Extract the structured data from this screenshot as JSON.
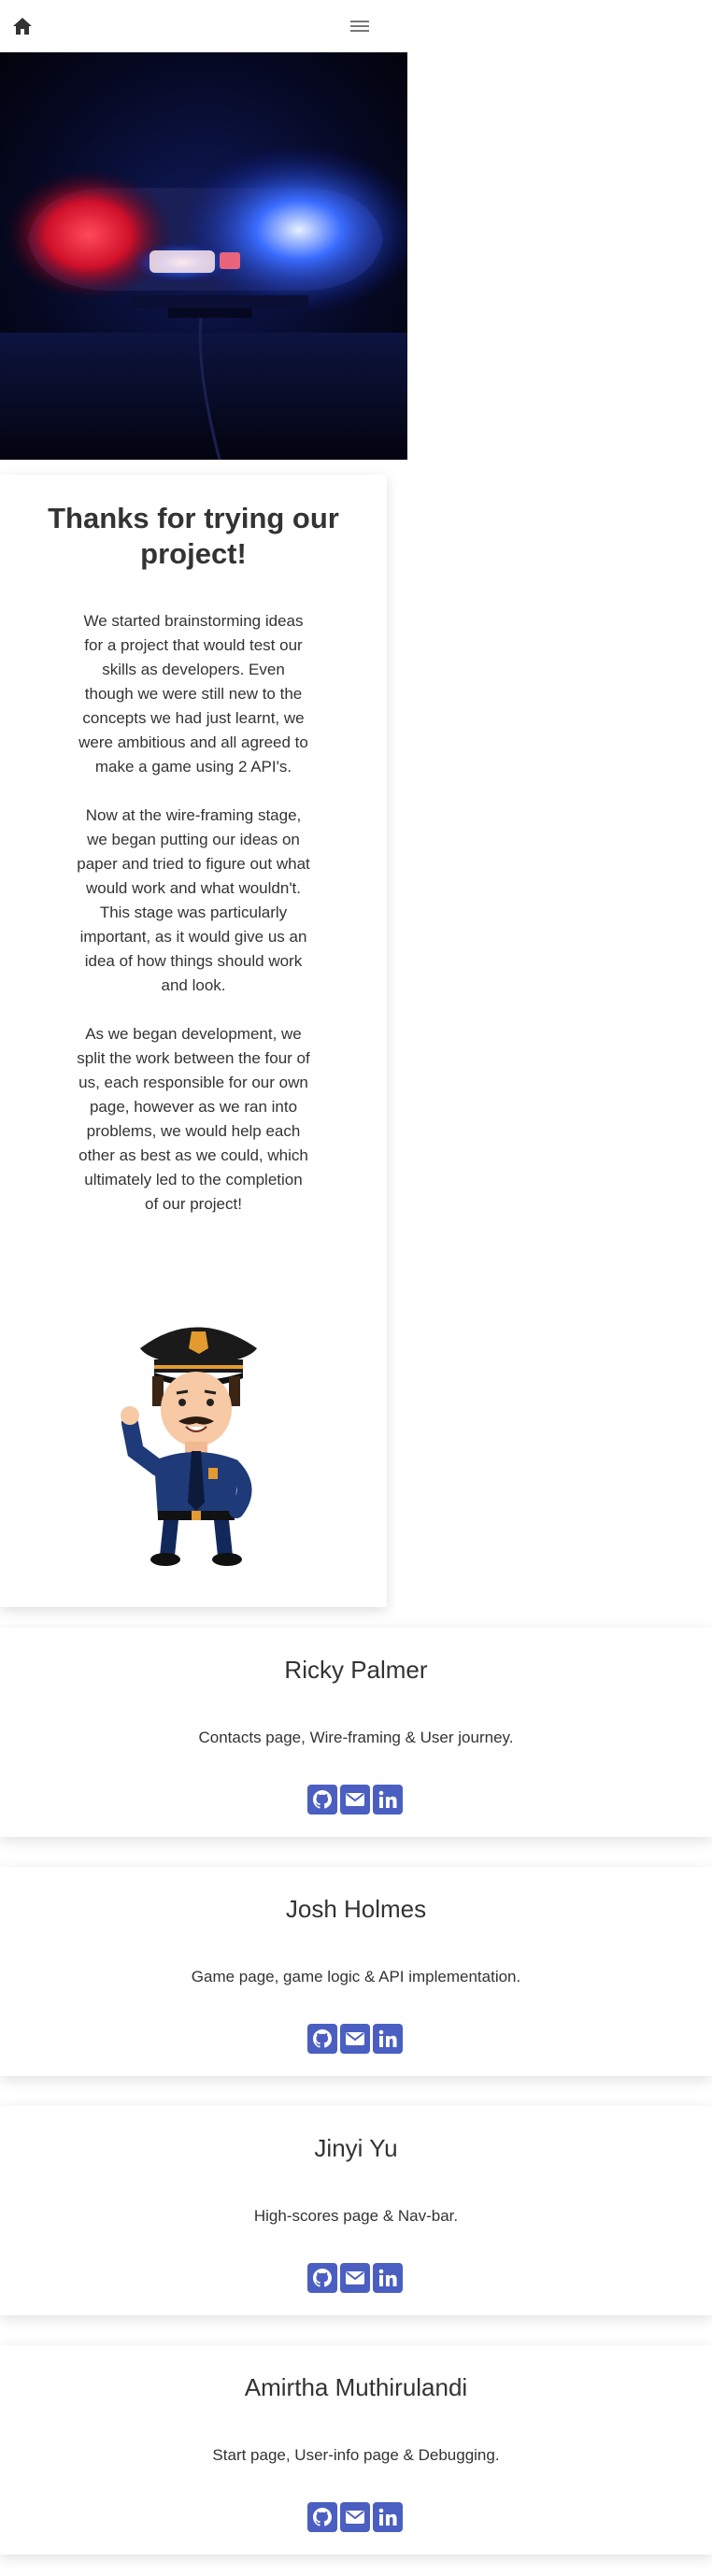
{
  "nav": {
    "home_icon": "home-icon",
    "menu_icon": "hamburger-menu-icon"
  },
  "about": {
    "title": "Thanks for trying our project!",
    "paragraphs": [
      "We started brainstorming ideas for a project that would test our skills as developers. Even though we were still new to the concepts we had just learnt, we were ambitious and all agreed to make a game using 2 API's.",
      "Now at the wire-framing stage, we began putting our ideas on paper and tried to figure out what would work and what wouldn't. This stage was particularly important, as it would give us an idea of how things should work and look.",
      "As we began development, we split the work between the four of us, each responsible for our own page, however as we ran into problems, we would help each other as best as we could, which ultimately led to the completion of our project!"
    ]
  },
  "team": [
    {
      "name": "Ricky Palmer",
      "role": "Contacts page, Wire-framing & User journey."
    },
    {
      "name": "Josh Holmes",
      "role": "Game page, game logic & API implementation."
    },
    {
      "name": "Jinyi Yu",
      "role": "High-scores page & Nav-bar."
    },
    {
      "name": "Amirtha Muthirulandi",
      "role": "Start page, User-info page & Debugging."
    }
  ],
  "social_icons": [
    "github-icon",
    "email-icon",
    "linkedin-icon"
  ],
  "colors": {
    "icon_accent": "#4a5fc1",
    "text": "#333333"
  }
}
